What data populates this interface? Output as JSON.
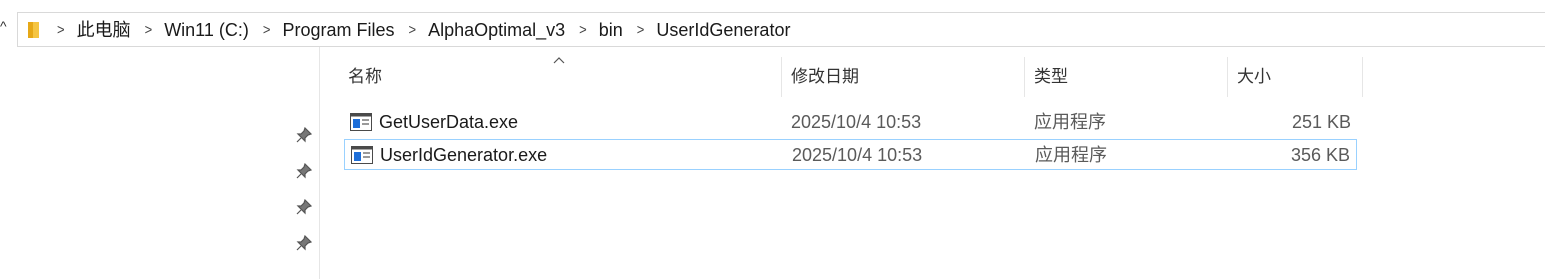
{
  "breadcrumb": {
    "items": [
      "此电脑",
      "Win11 (C:)",
      "Program Files",
      "AlphaOptimal_v3",
      "bin",
      "UserIdGenerator"
    ]
  },
  "columns": {
    "name": "名称",
    "date": "修改日期",
    "type": "类型",
    "size": "大小"
  },
  "files": [
    {
      "name": "GetUserData.exe",
      "date": "2025/10/4 10:53",
      "type": "应用程序",
      "size": "251 KB",
      "icon": "exe-icon"
    },
    {
      "name": "UserIdGenerator.exe",
      "date": "2025/10/4 10:53",
      "type": "应用程序",
      "size": "356 KB",
      "icon": "exe-icon"
    }
  ],
  "colors": {
    "selection_border": "#99d1ff",
    "folder": "#f0c040"
  }
}
